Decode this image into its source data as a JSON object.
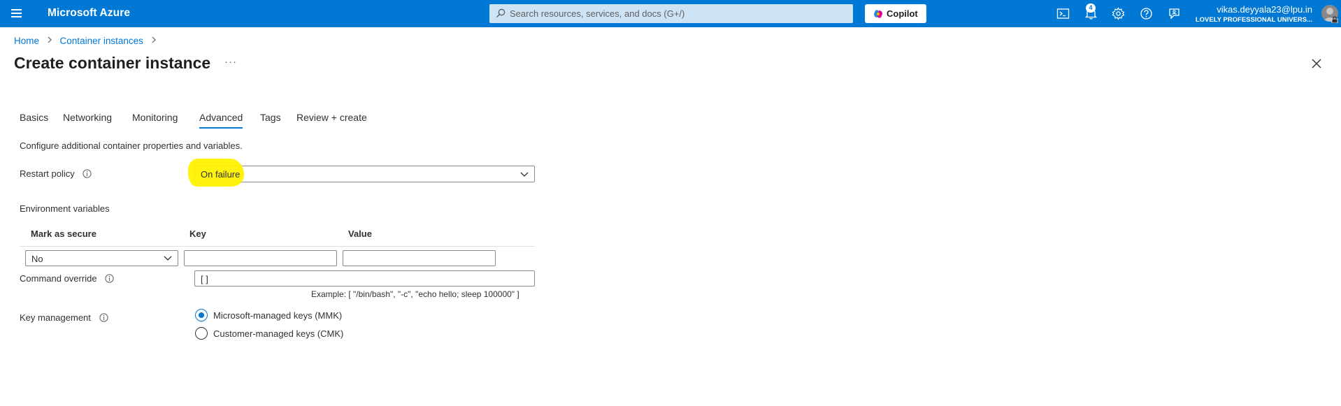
{
  "topbar": {
    "brand": "Microsoft Azure",
    "search_placeholder": "Search resources, services, and docs (G+/)",
    "copilot_label": "Copilot",
    "notification_count": "4",
    "user_email": "vikas.deyyala23@lpu.in",
    "user_org": "LOVELY PROFESSIONAL UNIVERS..."
  },
  "breadcrumb": {
    "items": [
      "Home",
      "Container instances"
    ]
  },
  "page": {
    "title": "Create container instance",
    "more": "···"
  },
  "tabs": [
    "Basics",
    "Networking",
    "Monitoring",
    "Advanced",
    "Tags",
    "Review + create"
  ],
  "active_tab": "Advanced",
  "form": {
    "description": "Configure additional container properties and variables.",
    "restart_policy": {
      "label": "Restart policy",
      "value": "On failure"
    },
    "env_vars": {
      "label": "Environment variables",
      "columns": [
        "Mark as secure",
        "Key",
        "Value"
      ],
      "row": {
        "secure": "No",
        "key": "",
        "value": ""
      }
    },
    "command_override": {
      "label": "Command override",
      "value": "[ ]",
      "example": "Example: [ \"/bin/bash\", \"-c\", \"echo hello; sleep 100000\" ]"
    },
    "key_management": {
      "label": "Key management",
      "options": [
        "Microsoft-managed keys (MMK)",
        "Customer-managed keys (CMK)"
      ],
      "selected": "Microsoft-managed keys (MMK)"
    }
  },
  "colors": {
    "azure_blue": "#0078d4",
    "highlight": "#fff200"
  }
}
